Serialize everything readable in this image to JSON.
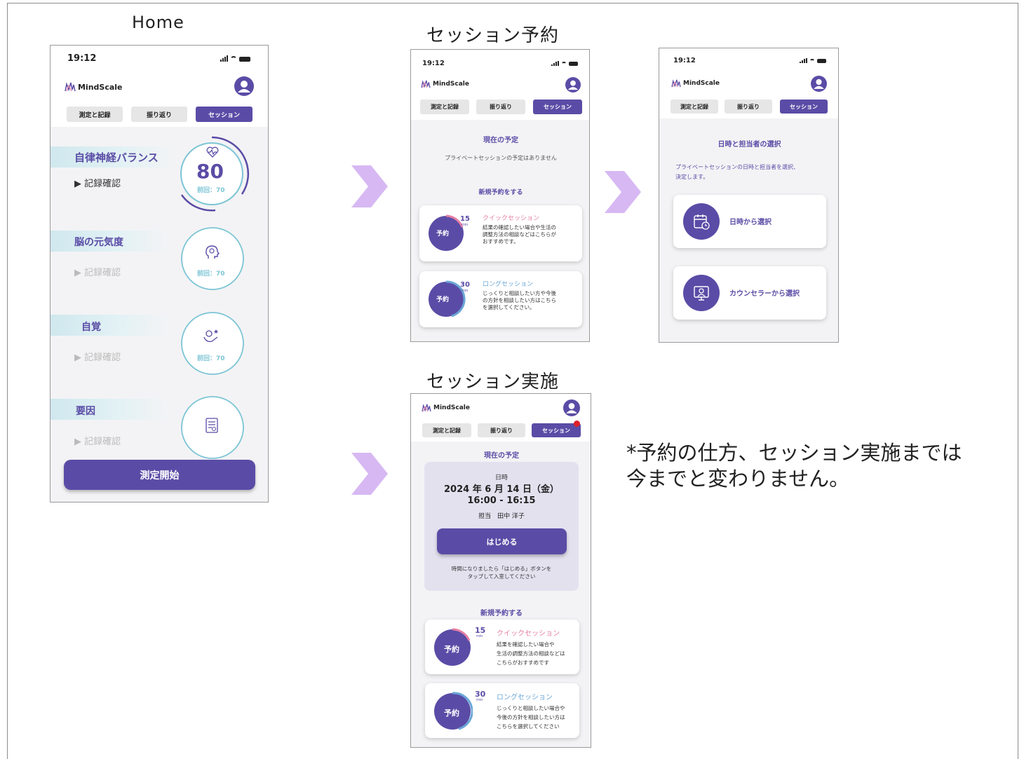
{
  "sections": {
    "home_title": "Home",
    "booking_title": "セッション予約",
    "session_title": "セッション実施"
  },
  "app": {
    "time": "19:12",
    "logo": "MindScale",
    "tabs": [
      "測定と記録",
      "振り返り",
      "セッション"
    ]
  },
  "home": {
    "items": [
      {
        "title": "自律神経バランス",
        "link": "▶ 記録確認",
        "score": "80",
        "prev": "前回：70",
        "icon": "heart-rate-icon"
      },
      {
        "title": "脳の元気度",
        "link": "▶ 記録確認",
        "prev": "前回：70",
        "icon": "brain-head-icon"
      },
      {
        "title": "自覚",
        "link": "▶ 記録確認",
        "prev": "前回：70",
        "icon": "self-awareness-icon"
      },
      {
        "title": "要因",
        "link": "▶ 記録確認",
        "icon": "report-icon"
      }
    ],
    "start_button": "測定開始"
  },
  "booking": {
    "current_heading": "現在の予定",
    "no_schedule": "プライベートセッションの予定はありません",
    "new_heading": "新規予約をする",
    "reserve_label": "予約",
    "quick": {
      "minutes": "15",
      "unit": "min",
      "title": "クイックセッション",
      "desc": [
        "結果の確認したい場合や生活の",
        "調整方法の相談などはこちらが",
        "おすすめです。"
      ]
    },
    "long": {
      "minutes": "30",
      "unit": "min",
      "title": "ロングセッション",
      "desc": [
        "じっくりと相談したい方や今後",
        "の方針を相談したい方はこちら",
        "を選択してください。"
      ]
    }
  },
  "select": {
    "heading": "日時と担当者の選択",
    "desc": [
      "プライベートセッションの日時と担当者を選択、",
      "決定します。"
    ],
    "by_date": "日時から選択",
    "by_counselor": "カウンセラーから選択"
  },
  "session": {
    "current_heading": "現在の予定",
    "date_label": "日時",
    "date": "2024 年 6 月 14 日（金）",
    "time": "16:00 - 16:15",
    "staff": "担当　田中 洋子",
    "start_button": "はじめる",
    "instruction": [
      "時間になりましたら「はじめる」ボタンを",
      "タップして入室してください"
    ],
    "new_heading": "新規予約する",
    "reserve_label": "予約",
    "quick": {
      "minutes": "15",
      "unit": "min",
      "title": "クイックセッション",
      "desc": [
        "結果を確認したい場合や",
        "生活の調整方法の相談などは",
        "こちらがおすすめです"
      ]
    },
    "long": {
      "minutes": "30",
      "unit": "min",
      "title": "ロングセッション",
      "desc": [
        "じっくりと相談したい場合や",
        "今後の方針を相談したい方は",
        "こちらを選択してください"
      ]
    }
  },
  "note": [
    "*予約の仕方、セッション実施までは",
    "今までと変わりません。"
  ],
  "colors": {
    "primary": "#5a4ca6",
    "teal": "#7cc5d5",
    "pink": "#e57fa5",
    "blue_title": "#6aa7d8",
    "arrow": "#d7b8f3"
  }
}
